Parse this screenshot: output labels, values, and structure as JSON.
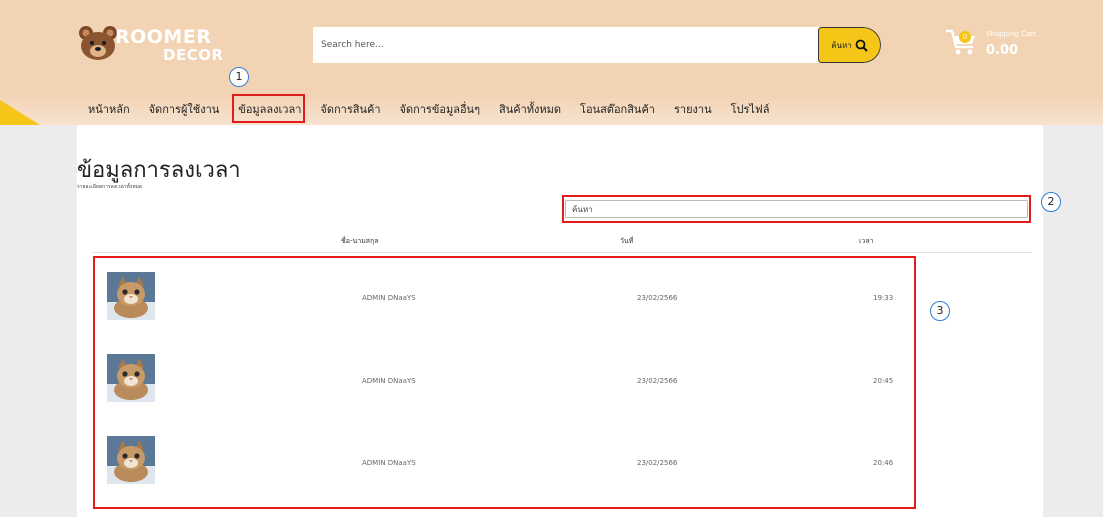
{
  "brand": {
    "line1": "ROOMER",
    "line2": "DECOR"
  },
  "search": {
    "placeholder": "Search here...",
    "button_label": "ค้นหา"
  },
  "cart": {
    "title": "Shopping Cart",
    "count": "0",
    "total": "0.00"
  },
  "nav": {
    "items": [
      {
        "label": "หน้าหลัก"
      },
      {
        "label": "จัดการผู้ใช้งาน"
      },
      {
        "label": "ข้อมูลลงเวลา"
      },
      {
        "label": "จัดการสินค้า"
      },
      {
        "label": "จัดการข้อมูลอื่นๆ"
      },
      {
        "label": "สินค้าทั้งหมด"
      },
      {
        "label": "โอนสต๊อกสินค้า"
      },
      {
        "label": "รายงาน"
      },
      {
        "label": "โปรไฟล์"
      }
    ],
    "active_index": 2
  },
  "page": {
    "title": "ข้อมูลการลงเวลา",
    "subtitle": "รายละเอียดการลงเวลาทั้งหมด",
    "search_placeholder": "ค้นหา"
  },
  "table": {
    "headers": {
      "name": "ชื่อ-นามสกุล",
      "date": "วันที่",
      "time": "เวลา"
    },
    "rows": [
      {
        "name": "ADMIN DNaaYS",
        "date": "23/02/2566",
        "time": "19:33"
      },
      {
        "name": "ADMIN DNaaYS",
        "date": "23/02/2566",
        "time": "20:45"
      },
      {
        "name": "ADMIN DNaaYS",
        "date": "23/02/2566",
        "time": "20:46"
      }
    ]
  },
  "annotations": {
    "marker1": "1",
    "marker2": "2",
    "marker3": "3"
  },
  "colors": {
    "header_bg": "#f2d3b3",
    "accent_yellow": "#f5c518",
    "annotation_red": "#e01c1c",
    "annotation_blue": "#2f7fd8",
    "page_bg": "#ececef"
  }
}
